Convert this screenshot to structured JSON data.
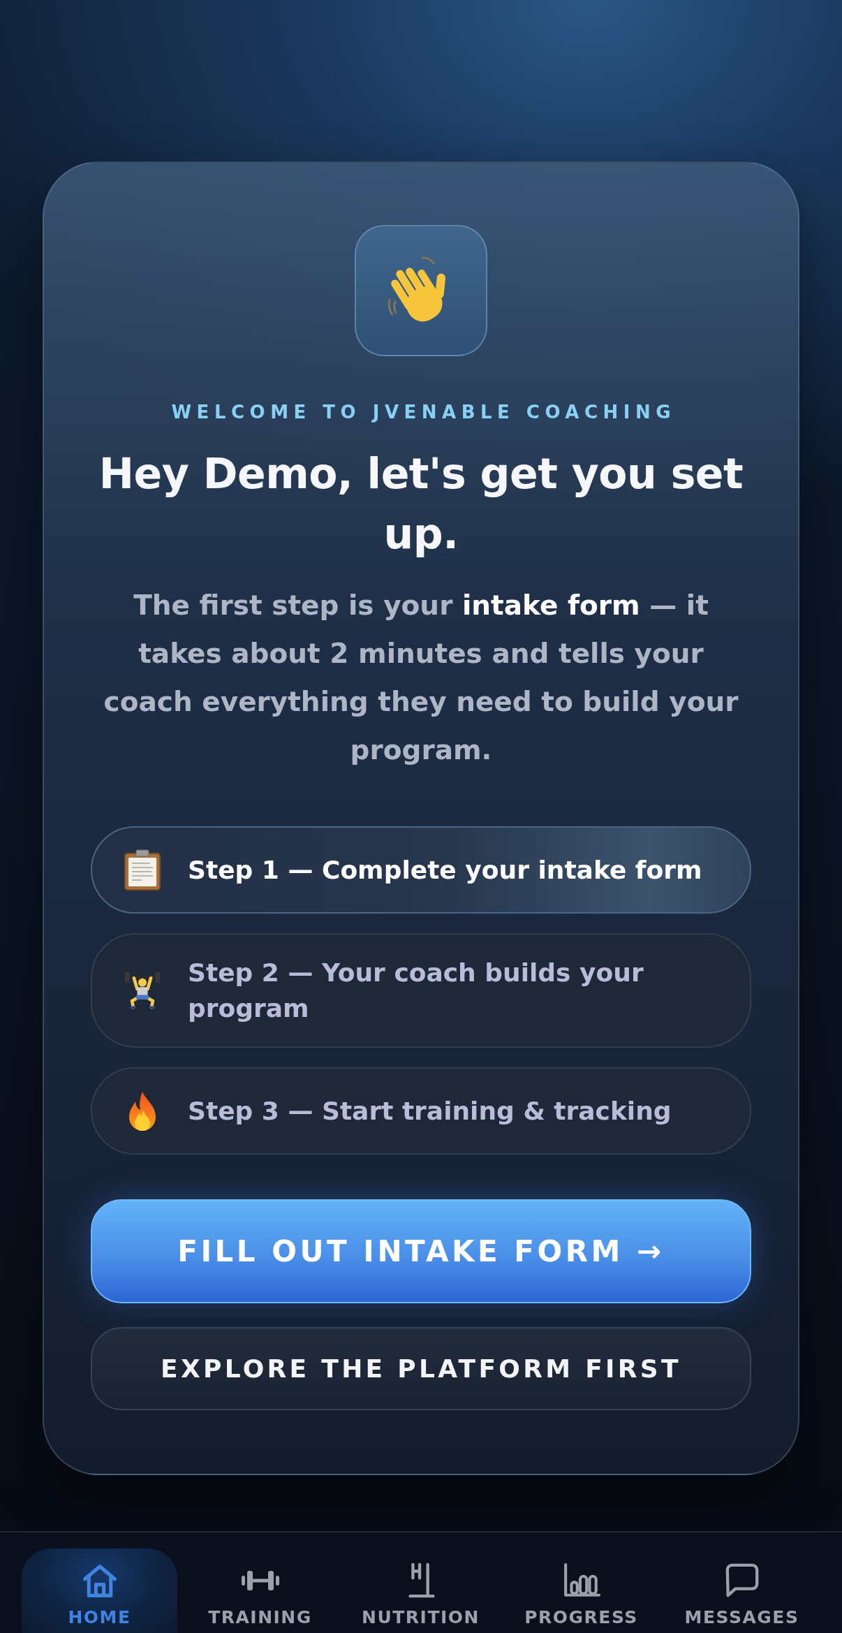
{
  "welcome": {
    "eyebrow": "WELCOME TO JVENABLE COACHING",
    "title": "Hey Demo, let's get you set up.",
    "description": "The first step is your **intake form** — it takes about 2 minutes and tells your coach everything they need to build your program."
  },
  "steps": [
    {
      "kind": "clipboard",
      "label": "Step 1 — Complete your intake form",
      "current": true
    },
    {
      "kind": "weightlifter",
      "label": "Step 2 — Your coach builds your program",
      "current": false
    },
    {
      "kind": "fire",
      "label": "Step 3 — Start training & tracking",
      "current": false
    }
  ],
  "buttons": [
    {
      "kind": "primary",
      "label": "FILL OUT INTAKE FORM →"
    },
    {
      "kind": "secondary",
      "label": "EXPLORE THE PLATFORM FIRST"
    }
  ],
  "bottom_nav": [
    {
      "kind": "home",
      "label": "HOME",
      "selected": true
    },
    {
      "kind": "training",
      "label": "TRAINING",
      "selected": false
    },
    {
      "kind": "nutrition",
      "label": "NUTRITION",
      "selected": false
    },
    {
      "kind": "progress",
      "label": "PROGRESS",
      "selected": false
    },
    {
      "kind": "messages",
      "label": "MESSAGES",
      "selected": false
    }
  ]
}
